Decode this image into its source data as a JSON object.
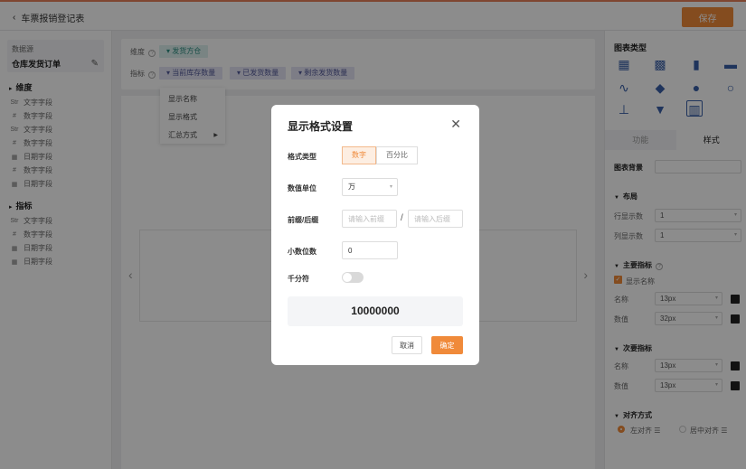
{
  "header": {
    "back_label": "车票报销登记表",
    "save_label": "保存"
  },
  "left": {
    "datasource_label": "数据源",
    "datasource_name": "仓库发货订单",
    "dim_title": "维度",
    "dim_fields": [
      {
        "icon": "Str",
        "label": "文字字段"
      },
      {
        "icon": "#",
        "label": "数字字段"
      },
      {
        "icon": "Str",
        "label": "文字字段"
      },
      {
        "icon": "#",
        "label": "数字字段"
      },
      {
        "icon": "▦",
        "label": "日期字段"
      },
      {
        "icon": "#",
        "label": "数字字段"
      },
      {
        "icon": "▦",
        "label": "日期字段"
      }
    ],
    "metric_title": "指标",
    "metric_fields": [
      {
        "icon": "Str",
        "label": "文字字段"
      },
      {
        "icon": "#",
        "label": "数字字段"
      },
      {
        "icon": "▦",
        "label": "日期字段"
      },
      {
        "icon": "▦",
        "label": "日期字段"
      }
    ]
  },
  "config": {
    "dimension_label": "维度",
    "dimension_chip": "▾ 发货方仓",
    "metric_label": "指标",
    "metric_chips": [
      "▾ 当前库存数量",
      "▾ 已发货数量",
      "▾ 剩余发货数量"
    ],
    "menu_items": [
      "显示名称",
      "显示格式",
      "汇总方式"
    ]
  },
  "right": {
    "chart_type_title": "图表类型",
    "tabs": [
      "功能",
      "样式"
    ],
    "bg_label": "图表背景",
    "layout_title": "布局",
    "row_count_label": "行显示数",
    "row_count_value": "1",
    "col_count_label": "列显示数",
    "col_count_value": "1",
    "primary_title": "主要指标",
    "show_name_label": "显示名称",
    "name_label": "名称",
    "name_size": "13px",
    "value_label": "数值",
    "value_size": "32px",
    "secondary_title": "次要指标",
    "sec_name_label": "名称",
    "sec_name_size": "13px",
    "sec_value_label": "数值",
    "sec_value_size": "13px",
    "align_title": "对齐方式",
    "align_left": "左对齐",
    "align_center": "居中对齐",
    "swatch_color": "#222222"
  },
  "modal": {
    "title": "显示格式设置",
    "format_type_label": "格式类型",
    "format_options": [
      "数字",
      "百分比"
    ],
    "unit_label": "数值单位",
    "unit_value": "万",
    "prefix_suffix_label": "前缀/后缀",
    "prefix_placeholder": "请输入前缀",
    "suffix_placeholder": "请输入后缀",
    "decimal_label": "小数位数",
    "decimal_value": "0",
    "thousands_label": "千分符",
    "preview_value": "10000000",
    "cancel_label": "取消",
    "ok_label": "确定",
    "accent_color": "#f08a3a"
  }
}
